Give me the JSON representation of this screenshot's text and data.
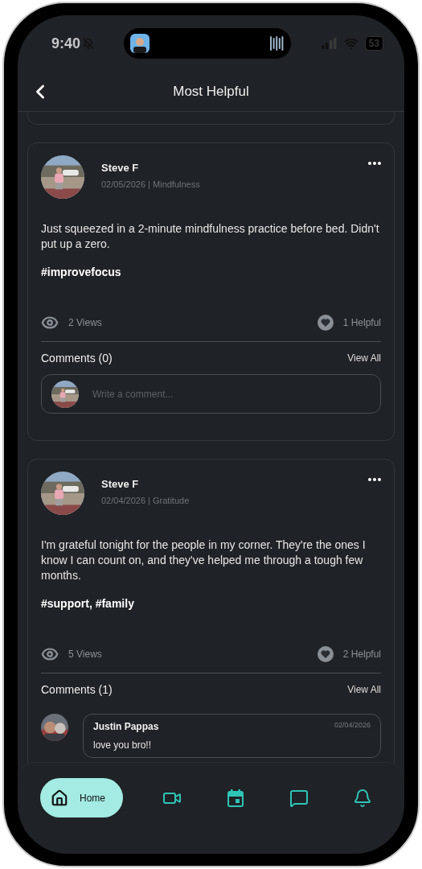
{
  "status_bar": {
    "time": "9:40",
    "battery": "53"
  },
  "header": {
    "title": "Most Helpful"
  },
  "posts": [
    {
      "author": "Steve F",
      "meta": "02/05/2026 | Mindfulness",
      "body": "Just squeezed in a 2-minute mindfulness practice before bed. Didn't put up a zero.",
      "tags": "#improvefocus",
      "views": "2 Views",
      "helpful": "1 Helpful",
      "comments_title": "Comments (0)",
      "view_all": "View All",
      "comment_placeholder": "Write a comment..."
    },
    {
      "author": "Steve F",
      "meta": "02/04/2026 | Gratitude",
      "body": "I'm grateful tonight for the people in my corner. They're the ones I know I can count on, and they've helped me through a tough few months.",
      "tags": "#support, #family",
      "views": "5 Views",
      "helpful": "2 Helpful",
      "comments_title": "Comments (1)",
      "view_all": "View All",
      "comments": [
        {
          "author": "Justin Pappas",
          "date": "02/04/2026",
          "text": "love you bro!!"
        }
      ]
    }
  ],
  "nav": {
    "items": [
      {
        "label": "Home",
        "selected": true
      },
      {
        "selected": false
      },
      {
        "selected": false
      },
      {
        "selected": false
      },
      {
        "selected": false
      }
    ]
  }
}
